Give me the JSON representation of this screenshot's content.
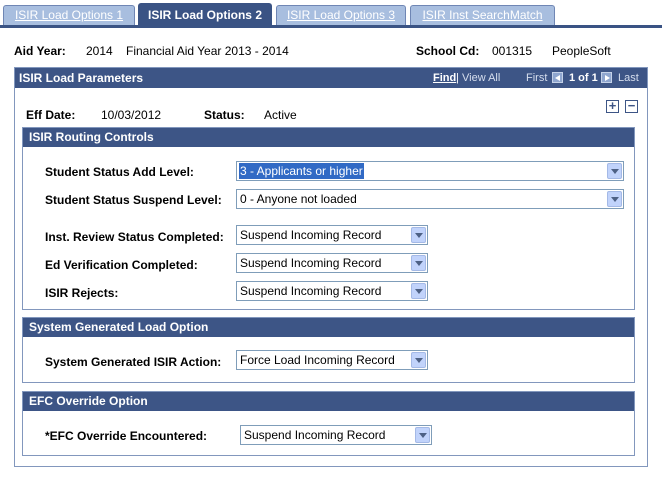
{
  "tabs": [
    {
      "label": "ISIR Load Options 1",
      "active": false
    },
    {
      "label": "ISIR Load Options 2",
      "active": true
    },
    {
      "label": "ISIR Load Options 3",
      "active": false
    },
    {
      "label": "ISIR Inst SearchMatch",
      "active": false
    }
  ],
  "header": {
    "aid_year_label": "Aid Year:",
    "aid_year_value": "2014",
    "aid_year_desc": "Financial Aid Year 2013 - 2014",
    "school_cd_label": "School Cd:",
    "school_cd_value": "001315",
    "school_cd_desc": "PeopleSoft"
  },
  "panel": {
    "title": "ISIR Load Parameters",
    "nav": {
      "find": "Find",
      "separator": "|",
      "view_all": "View All",
      "first": "First",
      "count": "1 of 1",
      "last": "Last"
    },
    "eff_date_label": "Eff Date:",
    "eff_date_value": "10/03/2012",
    "status_label": "Status:",
    "status_value": "Active",
    "add_symbol": "+",
    "remove_symbol": "−"
  },
  "routing": {
    "title": "ISIR Routing Controls",
    "add_level_label": "Student Status Add Level:",
    "add_level_value": "3 - Applicants or higher",
    "suspend_level_label": "Student Status Suspend Level:",
    "suspend_level_value": "0 - Anyone not loaded",
    "inst_review_label": "Inst. Review Status Completed:",
    "inst_review_value": "Suspend Incoming Record",
    "ed_verif_label": "Ed Verification Completed:",
    "ed_verif_value": "Suspend Incoming Record",
    "rejects_label": "ISIR Rejects:",
    "rejects_value": "Suspend Incoming Record"
  },
  "system_generated": {
    "title": "System Generated Load Option",
    "action_label": "System Generated ISIR Action:",
    "action_value": "Force Load Incoming Record"
  },
  "efc": {
    "title": "EFC Override Option",
    "encountered_label": "*EFC Override Encountered:",
    "encountered_value": "Suspend Incoming Record"
  }
}
